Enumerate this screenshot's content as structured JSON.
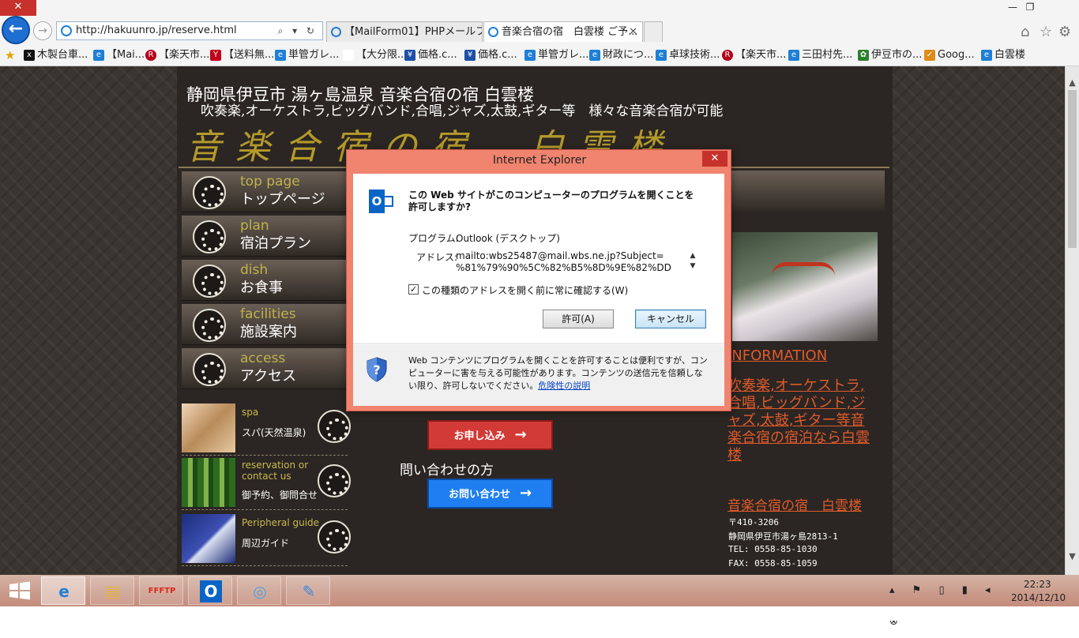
{
  "browser": {
    "address": "http://hakuunro.jp/reserve.html",
    "tabs": [
      {
        "label": "【MailForm01】PHPメールフォー...",
        "active": false
      },
      {
        "label": "音楽合宿の宿　白雲楼 ご予...",
        "active": true
      }
    ],
    "tab_close": "✕",
    "window_controls": {
      "minimize": "—",
      "restore": "❐",
      "close": "✕"
    },
    "home_icon": "⌂",
    "favorites_icon": "☆",
    "tools_icon": "⚙",
    "address_tools": "⌕ ▾ ↻",
    "favorites": [
      {
        "label": "木製台車...",
        "color": "#111111"
      },
      {
        "label": "【Mai...",
        "color": "#1f7fd6"
      },
      {
        "label": "【楽天市...",
        "color": "#b3001b"
      },
      {
        "label": "【送料無...",
        "color": "#c2001a"
      },
      {
        "label": "単管ガレ...",
        "color": "#1f7fd6"
      },
      {
        "label": "【大分限...",
        "color": "#444444"
      },
      {
        "label": "価格.c...",
        "color": "#1d4fa6"
      },
      {
        "label": "価格.c...",
        "color": "#1d4fa6"
      },
      {
        "label": "単管ガレ...",
        "color": "#1f7fd6"
      },
      {
        "label": "財政につ...",
        "color": "#1f7fd6"
      },
      {
        "label": "卓球技術...",
        "color": "#1f7fd6"
      },
      {
        "label": "【楽天市...",
        "color": "#b3001b"
      },
      {
        "label": "三田村先...",
        "color": "#1f7fd6"
      },
      {
        "label": "伊豆市の...",
        "color": "#2d7f2d"
      },
      {
        "label": "Goog...",
        "color": "#e08a1a"
      },
      {
        "label": "白雲楼",
        "color": "#1f7fd6"
      }
    ]
  },
  "site": {
    "title": "静岡県伊豆市 湯ヶ島温泉 音楽合宿の宿 白雲楼",
    "subtitle": "吹奏楽,オーケストラ,ビッグバンド,合唱,ジャズ,太鼓,ギター等　様々な音楽合宿が可能",
    "logo": "音楽合宿の宿　白雲楼",
    "nav": [
      {
        "en": "top page",
        "ja": "トップページ"
      },
      {
        "en": "plan",
        "ja": "宿泊プラン"
      },
      {
        "en": "dish",
        "ja": "お食事"
      },
      {
        "en": "facilities",
        "ja": "施設案内"
      },
      {
        "en": "access",
        "ja": "アクセス"
      }
    ],
    "subnav": [
      {
        "en": "spa",
        "ja": "スパ(天然温泉)"
      },
      {
        "en": "reservation or contact us",
        "ja": "御予約、御問合せ"
      },
      {
        "en": "Peripheral guide",
        "ja": "周辺ガイド"
      }
    ],
    "info_heading": "INFORMATION",
    "info_text": "吹奏楽,オーケストラ,合唱,ビッグバンド,ジャズ,太鼓,ギター等音楽合宿の宿泊なら白雲楼",
    "inn_name": "音楽合宿の宿　白雲楼",
    "postal": "〒410-3206",
    "address": "静岡県伊豆市湯ヶ島2813-1",
    "tel": "TEL: 0558-85-1030",
    "fax": "FAX: 0558-85-1059",
    "reserve_button": "お申し込み",
    "inquiry_label": "問い合わせの方",
    "inquiry_button": "お問い合わせ",
    "arrow": "→"
  },
  "dialog": {
    "title": "Internet Explorer",
    "close": "✕",
    "question": "この Web サイトがこのコンピューターのプログラムを開くことを許可しますか?",
    "program_label": "プログラム:",
    "program_value": "Outlook (デスクトップ)",
    "address_label": "アドレス:",
    "address_line1": "mailto:wbs25487@mail.wbs.ne.jp?Subject=",
    "address_line2": "%81%79%90%5C%82%B5%8D%9E%82%DD",
    "checkbox_checked": true,
    "checkbox_mark": "✓",
    "checkbox_label": "この種類のアドレスを開く前に常に確認する(W)",
    "allow": "許可(A)",
    "cancel": "キャンセル",
    "warning": "Web コンテンツにプログラムを開くことを許可することは便利ですが、コンピューターに害を与える可能性があります。コンテンツの送信元を信頼しない限り、許可しないでください。",
    "risk_link": "危険性の説明",
    "scroll_up": "▲",
    "scroll_down": "▼"
  },
  "taskbar": {
    "apps": [
      "e",
      "▤",
      "FFFTP",
      "O",
      "◎",
      "✎"
    ],
    "tray_icons": "▴ ⚑ ▯ ▮ ◂ ⊗",
    "time": "22:23",
    "date": "2014/12/10"
  }
}
